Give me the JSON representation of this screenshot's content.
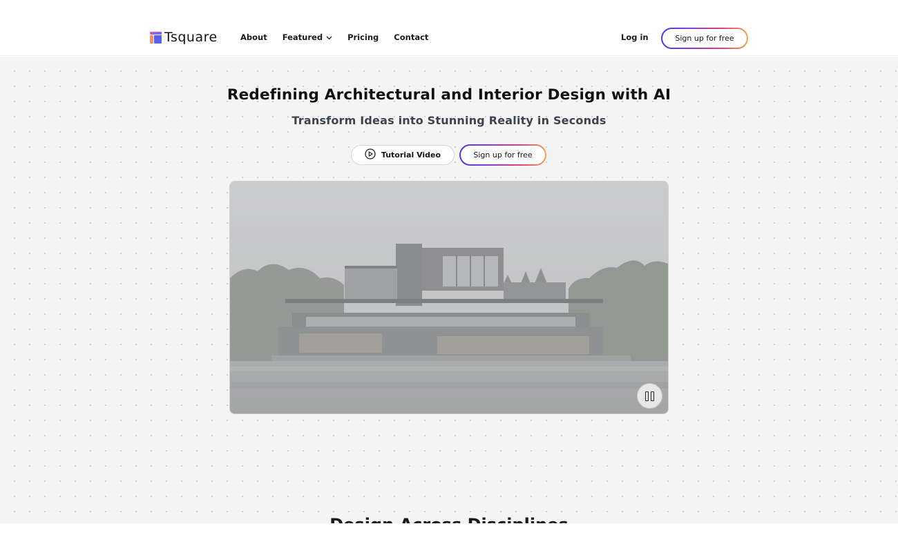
{
  "brand": {
    "name": "Tsquare"
  },
  "nav": {
    "items": [
      {
        "label": "About"
      },
      {
        "label": "Featured",
        "has_dropdown": true
      },
      {
        "label": "Pricing"
      },
      {
        "label": "Contact"
      }
    ],
    "login_label": "Log in",
    "signup_label": "Sign up for free"
  },
  "hero": {
    "title": "Redefining Architectural and Interior Design with AI",
    "subtitle": "Transform Ideas into Stunning Reality in Seconds",
    "tutorial_label": "Tutorial Video",
    "signup_label": "Sign up for free"
  },
  "video": {
    "state": "playing",
    "control_icon": "pause-icon"
  },
  "next_section": {
    "title_partial": "Design Across Disciplines"
  },
  "colors": {
    "gradient": [
      "#4a3af0",
      "#8a3ad6",
      "#e2407a",
      "#f5a34a"
    ],
    "background": "#f4f4f4",
    "text": "#111111"
  }
}
